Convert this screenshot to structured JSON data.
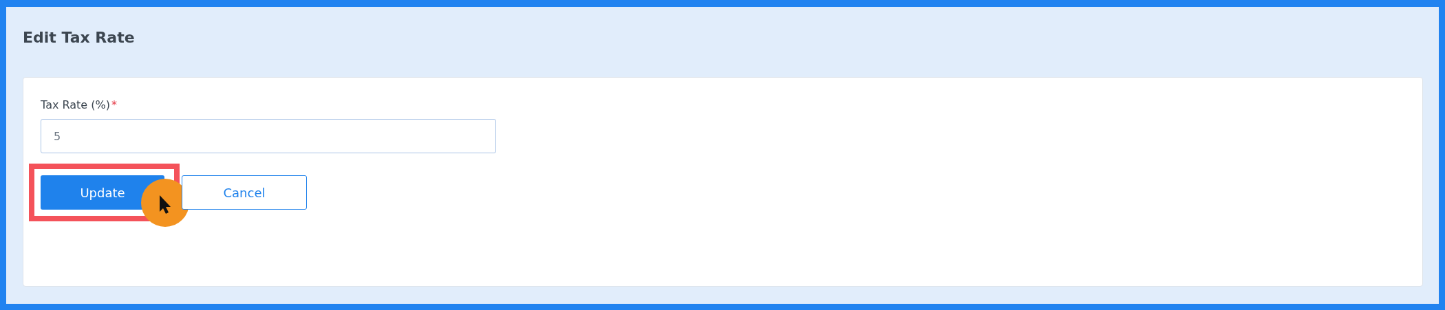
{
  "page": {
    "title": "Edit Tax Rate"
  },
  "form": {
    "field": {
      "label": "Tax Rate (%)",
      "required_mark": "*",
      "value": "5"
    },
    "buttons": [
      {
        "label": "Update",
        "kind": "primary",
        "highlighted": true
      },
      {
        "label": "Cancel",
        "kind": "secondary",
        "highlighted": false
      }
    ]
  }
}
